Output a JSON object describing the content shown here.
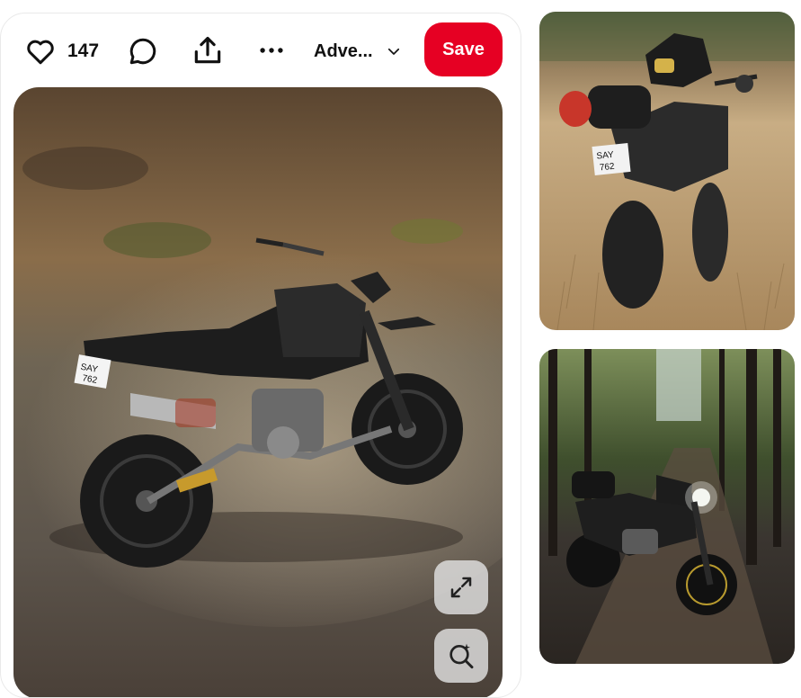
{
  "pin": {
    "like_count": "147",
    "board_name": "Adve...",
    "save_label": "Save",
    "main_image_alt": "Black Honda dirt bike parked on a gravel forest trail",
    "plate_text": "SAY 762"
  },
  "icons": {
    "like": "heart-icon",
    "comment": "comment-icon",
    "share": "share-icon",
    "more": "more-icon",
    "board_dropdown": "chevron-down-icon",
    "expand": "expand-icon",
    "visual_search": "visual-search-icon"
  },
  "colors": {
    "accent": "#e60023",
    "text": "#111111",
    "card_border": "#e9e9e9"
  },
  "related_pins": [
    {
      "alt": "Motorcycle with helmet and red bag standing in dry grass field",
      "plate_text": "SAY 762"
    },
    {
      "alt": "Motorcycle with headlight on in a dark forest road"
    }
  ]
}
